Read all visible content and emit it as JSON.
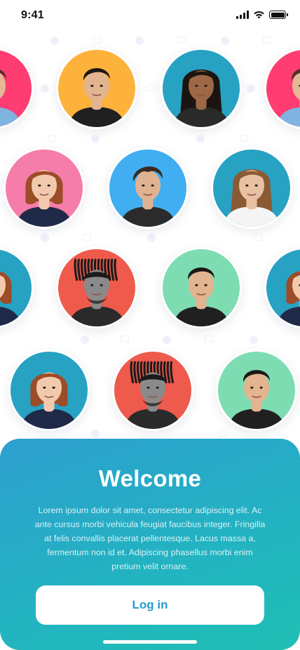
{
  "status_bar": {
    "time": "9:41"
  },
  "colors": {
    "yellow": "#fdb23c",
    "teal": "#27a2c3",
    "pink": "#f57da9",
    "blue": "#40aef0",
    "red": "#ee5a4c",
    "green": "#7ddcb2",
    "magenta": "#ff3d73",
    "card_start": "#2d9fcf",
    "card_end": "#1fc0b4",
    "button_text": "#2a9ccb"
  },
  "avatars": [
    {
      "person": "man-blue-shirt",
      "bg": "magenta"
    },
    {
      "person": "young-man-dark-hair",
      "bg": "yellow"
    },
    {
      "person": "woman-curly-hair",
      "bg": "teal"
    },
    {
      "person": "man-blue-shirt",
      "bg": "magenta"
    },
    {
      "person": "woman-auburn-bob",
      "bg": "pink"
    },
    {
      "person": "young-man-tousled-hair",
      "bg": "blue"
    },
    {
      "person": "woman-long-hair",
      "bg": "teal"
    },
    {
      "person": "woman-auburn-bob",
      "bg": "teal"
    },
    {
      "person": "man-dreadlocks",
      "bg": "red"
    },
    {
      "person": "young-man-dark-hair",
      "bg": "green"
    },
    {
      "person": "woman-auburn-bob",
      "bg": "teal"
    },
    {
      "person": "woman-auburn-bob",
      "bg": "teal"
    },
    {
      "person": "man-dreadlocks",
      "bg": "red"
    },
    {
      "person": "young-man-dark-hair",
      "bg": "green"
    }
  ],
  "welcome": {
    "title": "Welcome",
    "body": "Lorem ipsum dolor sit amet, consectetur adipiscing elit. Ac ante cursus morbi vehicula feugiat faucibus integer. Fringilla at felis convallis placerat pellentesque. Lacus massa a, fermentum non id et. Adipiscing phasellus morbi enim pretium velit ornare.",
    "login_label": "Log in"
  }
}
